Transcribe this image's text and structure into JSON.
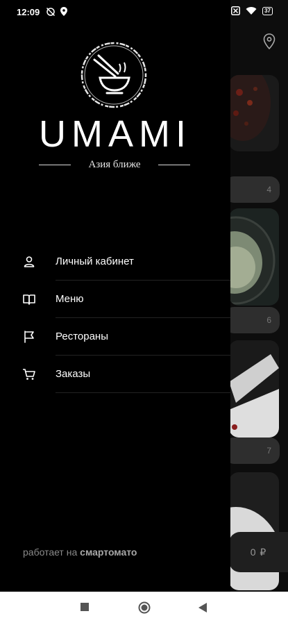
{
  "status_bar": {
    "time": "12:09",
    "battery": "37",
    "icons": [
      "sync-off-icon",
      "location-icon",
      "sim-icon",
      "wifi-icon",
      "battery-icon"
    ]
  },
  "brand": {
    "name": "UMAMI",
    "tagline": "Азия ближе"
  },
  "drawer_menu": {
    "items": [
      {
        "label": "Личный кабинет",
        "icon": "user-icon"
      },
      {
        "label": "Меню",
        "icon": "book-icon"
      },
      {
        "label": "Рестораны",
        "icon": "flag-icon"
      },
      {
        "label": "Заказы",
        "icon": "cart-icon"
      }
    ]
  },
  "footer": {
    "prefix": "работает на",
    "brand": "смартомато"
  },
  "background_app": {
    "badges": [
      "4",
      "6",
      "7"
    ],
    "cart_total": "0 ₽"
  },
  "nav_bar": {
    "buttons": [
      "recents-button",
      "home-button",
      "back-button"
    ]
  },
  "colors": {
    "drawer_bg": "#000000",
    "text": "#ffffff",
    "muted": "#8a8a8a",
    "divider": "#232323",
    "nav_bg": "#ffffff"
  }
}
